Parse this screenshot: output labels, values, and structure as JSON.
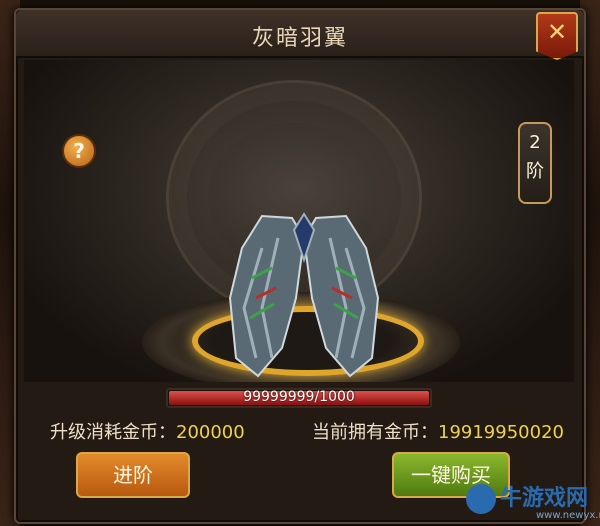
{
  "dialog": {
    "title": "灰暗羽翼",
    "close_icon": "close-x-icon",
    "help_label": "?",
    "rank": {
      "value": "2",
      "unit": "阶"
    }
  },
  "item": {
    "icon": "dark-wings-icon",
    "progress_text": "99999999/1000",
    "progress_fraction": 1.0
  },
  "cost": {
    "upgrade_label": "升级消耗金币：",
    "upgrade_value": "200000",
    "owned_label": "当前拥有金币：",
    "owned_value": "19919950020"
  },
  "buttons": {
    "advance_label": "进阶",
    "buy_label": "一键购买"
  },
  "watermark": {
    "brand": "牛游戏网",
    "site": "www.newyx.net"
  },
  "colors": {
    "gold": "#f0d24a",
    "advance_button": "#e38a2a",
    "buy_button": "#8ab82c",
    "progress_fill": "#c82a24"
  }
}
